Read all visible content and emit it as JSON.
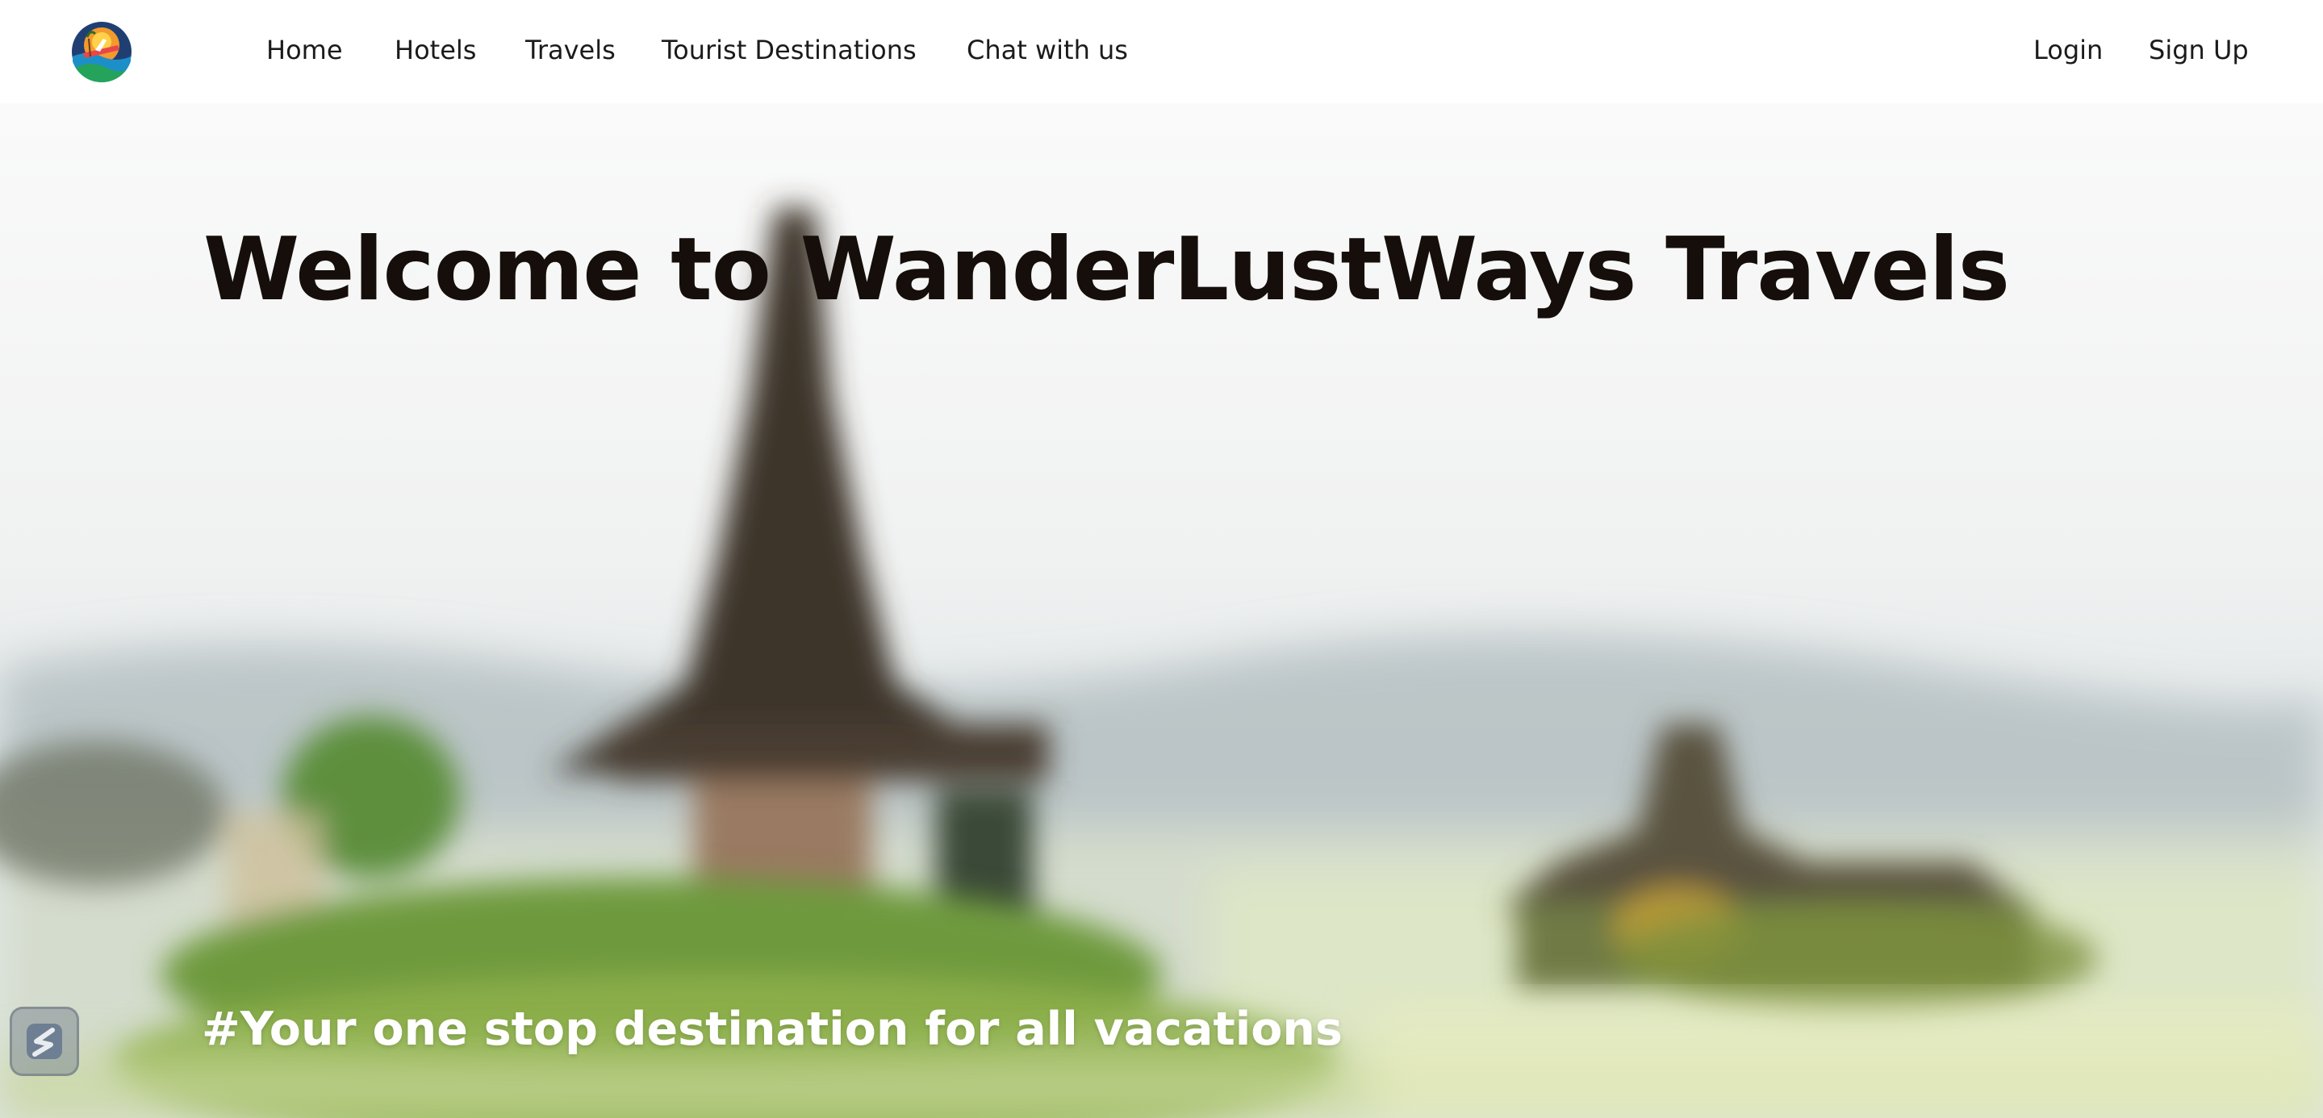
{
  "nav": {
    "logo_icon": "travel-globe-logo-icon",
    "links": [
      {
        "label": "Home"
      },
      {
        "label": "Hotels"
      },
      {
        "label": "Travels"
      },
      {
        "label": "Tourist Destinations"
      },
      {
        "label": "Chat with us"
      }
    ],
    "auth": {
      "login": "Login",
      "signup": "Sign Up"
    }
  },
  "hero": {
    "title": "Welcome to WanderLustWays Travels",
    "tagline": "#Your one stop destination for all vacations",
    "background_icon": "blurred-temple-photo",
    "widget_icon": "floating-widget-icon"
  },
  "colors": {
    "title": "#150e0a",
    "nav_text": "#1b1b1b",
    "tagline": "#ffffff"
  }
}
